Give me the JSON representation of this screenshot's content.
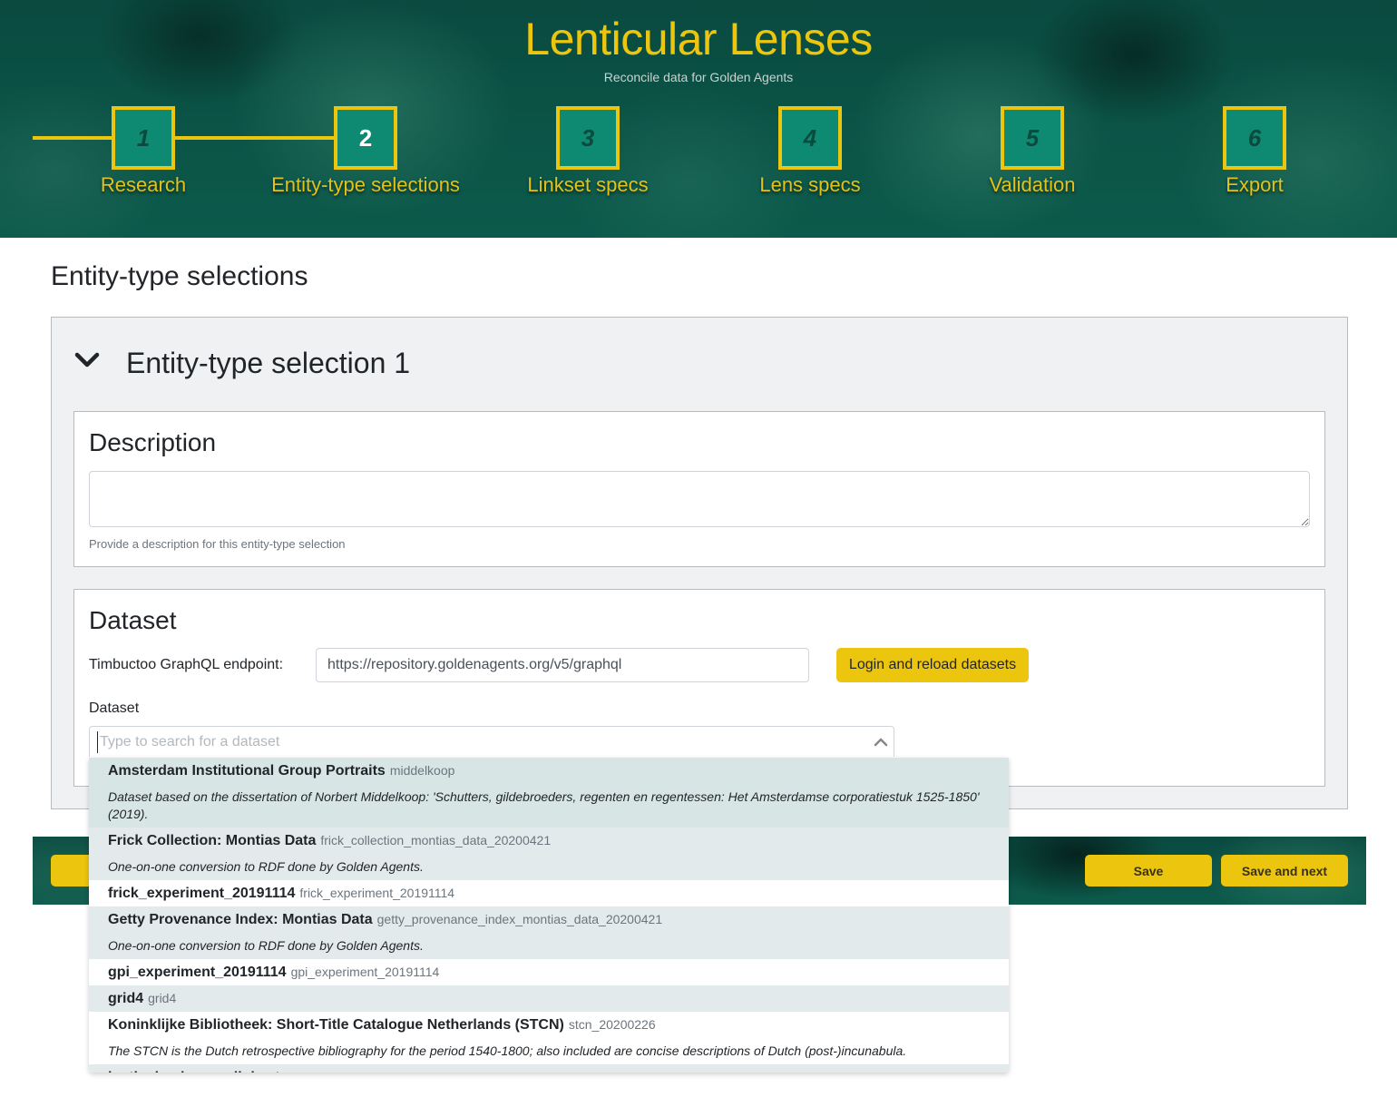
{
  "header": {
    "title": "Lenticular Lenses",
    "subtitle": "Reconcile data for Golden Agents",
    "steps": [
      {
        "number": "1",
        "label": "Research"
      },
      {
        "number": "2",
        "label": "Entity-type selections"
      },
      {
        "number": "3",
        "label": "Linkset specs"
      },
      {
        "number": "4",
        "label": "Lens specs"
      },
      {
        "number": "5",
        "label": "Validation"
      },
      {
        "number": "6",
        "label": "Export"
      }
    ],
    "active_step": "2"
  },
  "page": {
    "title": "Entity-type selections"
  },
  "selection_card": {
    "title": "Entity-type selection 1",
    "expanded": true,
    "description": {
      "heading": "Description",
      "value": "",
      "help": "Provide a description for this entity-type selection"
    },
    "dataset": {
      "heading": "Dataset",
      "endpoint_label": "Timbuctoo GraphQL endpoint:",
      "endpoint_value": "https://repository.goldenagents.org/v5/graphql",
      "login_button": "Login and reload datasets",
      "dataset_label": "Dataset",
      "search_placeholder": "Type to search for a dataset",
      "search_value": ""
    }
  },
  "footer": {
    "save": "Save",
    "save_and_next": "Save and next"
  },
  "dataset_options": [
    {
      "name": "Amsterdam Institutional Group Portraits",
      "id": "middelkoop",
      "description": "Dataset based on the dissertation of Norbert Middelkoop: 'Schutters, gildebroeders, regenten en regentessen: Het Amsterdamse corporatiestuk 1525-1850' (2019)."
    },
    {
      "name": "Frick Collection: Montias Data",
      "id": "frick_collection_montias_data_20200421",
      "description": "One-on-one conversion to RDF done by Golden Agents."
    },
    {
      "name": "frick_experiment_20191114",
      "id": "frick_experiment_20191114",
      "description": ""
    },
    {
      "name": "Getty Provenance Index: Montias Data",
      "id": "getty_provenance_index_montias_data_20200421",
      "description": "One-on-one conversion to RDF done by Golden Agents."
    },
    {
      "name": "gpi_experiment_20191114",
      "id": "gpi_experiment_20191114",
      "description": ""
    },
    {
      "name": "grid4",
      "id": "grid4",
      "description": ""
    },
    {
      "name": "Koninklijke Bibliotheek: Short-Title Catalogue Netherlands (STCN)",
      "id": "stcn_20200226",
      "description": "The STCN is the Dutch retrospective bibliography for the period 1540-1800; also included are concise descriptions of Dutch (post-)incunabula."
    },
    {
      "name": "lenticular_lenses_linkset",
      "id": "lenticular_lenses_linkset",
      "description": ""
    }
  ],
  "colors": {
    "accent_yellow": "#ecc50f",
    "header_green": "#0b5346",
    "step_box_green": "#0e8a72"
  }
}
